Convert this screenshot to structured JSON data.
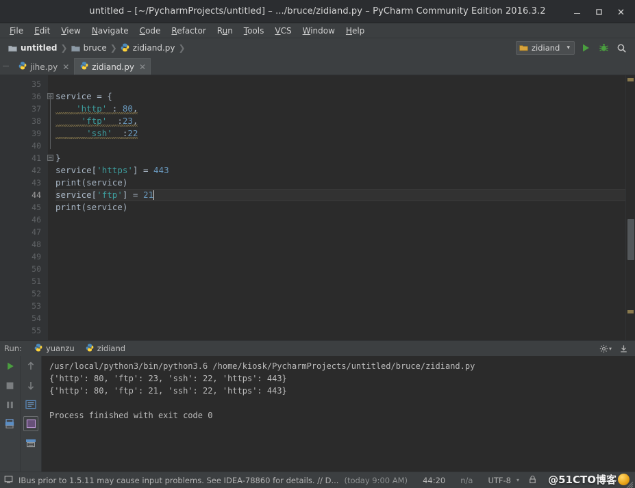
{
  "window": {
    "title": "untitled – [~/PycharmProjects/untitled] – .../bruce/zidiand.py – PyCharm Community Edition 2016.3.2",
    "minimize_label": "–",
    "maximize_label": "□",
    "close_label": "✕"
  },
  "menubar": {
    "items": [
      {
        "label": "File",
        "mnemonic": "F",
        "rest": "ile"
      },
      {
        "label": "Edit",
        "mnemonic": "E",
        "rest": "dit"
      },
      {
        "label": "View",
        "mnemonic": "V",
        "rest": "iew"
      },
      {
        "label": "Navigate",
        "mnemonic": "N",
        "rest": "avigate"
      },
      {
        "label": "Code",
        "mnemonic": "C",
        "rest": "ode"
      },
      {
        "label": "Refactor",
        "mnemonic": "R",
        "rest": "efactor"
      },
      {
        "label": "Run",
        "mnemonic": "R",
        "rest": "un",
        "pre": "R",
        "mid": "u",
        "post": "n"
      },
      {
        "label": "Tools",
        "mnemonic": "T",
        "rest": "ools"
      },
      {
        "label": "VCS",
        "mnemonic": "V",
        "rest": "CS"
      },
      {
        "label": "Window",
        "mnemonic": "W",
        "rest": "indow"
      },
      {
        "label": "Help",
        "mnemonic": "H",
        "rest": "elp"
      }
    ]
  },
  "breadcrumb": {
    "items": [
      {
        "label": "untitled",
        "icon": "folder-icon"
      },
      {
        "label": "bruce",
        "icon": "folder-icon"
      },
      {
        "label": "zidiand.py",
        "icon": "python-file-icon"
      }
    ],
    "separator": "❯"
  },
  "toolbar": {
    "run_config": "zidiand",
    "run_config_icon": "python-config-icon",
    "dropdown_caret": "▾",
    "run_button": "run-icon",
    "debug_button": "debug-icon",
    "search_button": "search-icon"
  },
  "tabs": [
    {
      "label": "jihe.py",
      "icon": "python-file-icon",
      "active": false,
      "close": "✕"
    },
    {
      "label": "zidiand.py",
      "icon": "python-file-icon",
      "active": true,
      "close": "✕"
    }
  ],
  "editor": {
    "first_line_number": 35,
    "current_line_number": 44,
    "lines": [
      {
        "n": 35,
        "segments": []
      },
      {
        "n": 36,
        "fold": "minus",
        "segments": [
          {
            "t": "service = {",
            "c": "tok-plain"
          }
        ]
      },
      {
        "n": 37,
        "warn": true,
        "segments": [
          {
            "t": "    ",
            "c": "tok-plain"
          },
          {
            "t": "'http'",
            "c": "tok-str2"
          },
          {
            "t": " : ",
            "c": "tok-plain"
          },
          {
            "t": "80",
            "c": "tok-num"
          },
          {
            "t": ",",
            "c": "tok-plain"
          }
        ]
      },
      {
        "n": 38,
        "warn": true,
        "segments": [
          {
            "t": "     ",
            "c": "tok-plain"
          },
          {
            "t": "'ftp'",
            "c": "tok-str2"
          },
          {
            "t": "  :",
            "c": "tok-plain"
          },
          {
            "t": "23",
            "c": "tok-num"
          },
          {
            "t": ",",
            "c": "tok-plain"
          }
        ]
      },
      {
        "n": 39,
        "warn": true,
        "segments": [
          {
            "t": "      ",
            "c": "tok-plain"
          },
          {
            "t": "'ssh'",
            "c": "tok-str2"
          },
          {
            "t": "  :",
            "c": "tok-plain"
          },
          {
            "t": "22",
            "c": "tok-num"
          }
        ]
      },
      {
        "n": 40,
        "segments": []
      },
      {
        "n": 41,
        "fold": "minus",
        "segments": [
          {
            "t": "}",
            "c": "tok-plain"
          }
        ]
      },
      {
        "n": 42,
        "segments": [
          {
            "t": "service[",
            "c": "tok-plain"
          },
          {
            "t": "'https'",
            "c": "tok-str2"
          },
          {
            "t": "] = ",
            "c": "tok-plain"
          },
          {
            "t": "443",
            "c": "tok-num"
          }
        ]
      },
      {
        "n": 43,
        "segments": [
          {
            "t": "print(service)",
            "c": "tok-plain"
          }
        ]
      },
      {
        "n": 44,
        "current": true,
        "caret": true,
        "segments": [
          {
            "t": "service[",
            "c": "tok-plain"
          },
          {
            "t": "'ftp'",
            "c": "tok-str2"
          },
          {
            "t": "] = ",
            "c": "tok-plain"
          },
          {
            "t": "21",
            "c": "tok-num"
          }
        ]
      },
      {
        "n": 45,
        "segments": [
          {
            "t": "print(service)",
            "c": "tok-plain"
          }
        ]
      },
      {
        "n": 46,
        "segments": []
      },
      {
        "n": 47,
        "segments": []
      },
      {
        "n": 48,
        "segments": []
      },
      {
        "n": 49,
        "segments": []
      },
      {
        "n": 50,
        "segments": []
      },
      {
        "n": 51,
        "segments": []
      },
      {
        "n": 52,
        "segments": []
      },
      {
        "n": 53,
        "segments": []
      },
      {
        "n": 54,
        "segments": []
      },
      {
        "n": 55,
        "segments": []
      }
    ]
  },
  "run_panel": {
    "label": "Run:",
    "tabs": [
      {
        "label": "yuanzu",
        "icon": "python-run-icon",
        "active": false
      },
      {
        "label": "zidiand",
        "icon": "python-run-icon",
        "active": true
      }
    ],
    "settings_icon": "gear-icon",
    "hide_icon": "hide-panel-icon",
    "controls": [
      {
        "name": "rerun-icon"
      },
      {
        "name": "stop-icon"
      },
      {
        "name": "pause-icon"
      },
      {
        "name": "print-icon"
      }
    ],
    "controls2": [
      {
        "name": "up-arrow-icon"
      },
      {
        "name": "down-arrow-icon"
      },
      {
        "name": "soft-wrap-icon"
      },
      {
        "name": "scroll-to-end-icon"
      },
      {
        "name": "clear-all-icon"
      }
    ],
    "expand_label": "»",
    "console_lines": [
      "/usr/local/python3/bin/python3.6 /home/kiosk/PycharmProjects/untitled/bruce/zidiand.py",
      "{'http': 80, 'ftp': 23, 'ssh': 22, 'https': 443}",
      "{'http': 80, 'ftp': 21, 'ssh': 22, 'https': 443}",
      "",
      "Process finished with exit code 0"
    ]
  },
  "statusbar": {
    "icon": "ide-message-icon",
    "message": "IBus prior to 1.5.11 may cause input problems. See IDEA-78860 for details. // D...",
    "time": "(today 9:00 AM)",
    "caret_position": "44:20",
    "line_separator": "n/a",
    "encoding": "UTF-8",
    "encoding_caret": "▾",
    "lock_icon": "lock-icon"
  },
  "watermark": {
    "text": "@51CTO博客"
  },
  "colors": {
    "accent_run_green": "#4a9e3f",
    "window_bg": "#3c3f41",
    "editor_bg": "#2b2b2b",
    "gutter_bg": "#313335",
    "string_token": "#3d9e9e",
    "number_token": "#6897bb",
    "text_token": "#a9b7c6",
    "warning_squiggle": "#8a7a4e"
  }
}
